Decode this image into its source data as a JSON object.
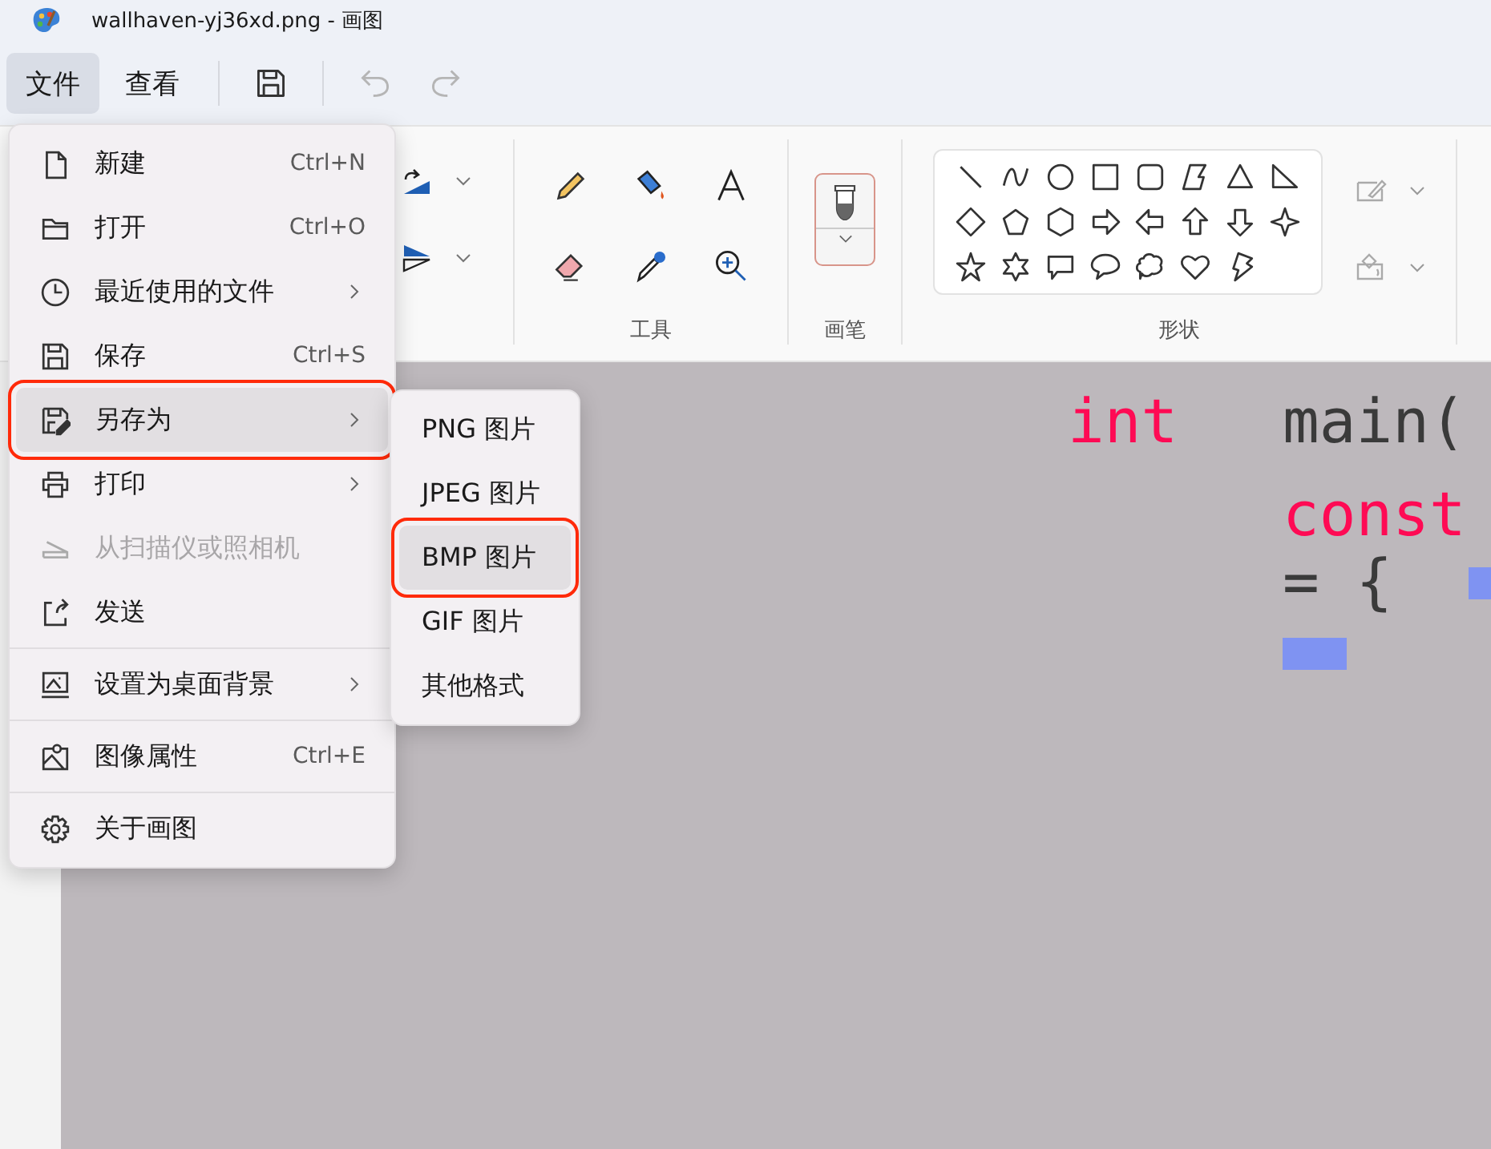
{
  "window": {
    "title": "wallhaven-yj36xd.png - 画图"
  },
  "menubar": [
    {
      "label": "文件",
      "selected": true
    },
    {
      "label": "查看",
      "selected": false
    }
  ],
  "ribbon": {
    "groups": [
      {
        "label": "工具"
      },
      {
        "label": "画笔"
      },
      {
        "label": "形状"
      }
    ]
  },
  "file_menu": {
    "groups": [
      [
        {
          "label": "新建",
          "shortcut": "Ctrl+N",
          "submenu": false,
          "disabled": false,
          "selected": false,
          "highlighted": false
        },
        {
          "label": "打开",
          "shortcut": "Ctrl+O",
          "submenu": false,
          "disabled": false,
          "selected": false,
          "highlighted": false
        },
        {
          "label": "最近使用的文件",
          "submenu": true,
          "disabled": false,
          "selected": false,
          "highlighted": false
        },
        {
          "label": "保存",
          "shortcut": "Ctrl+S",
          "submenu": false,
          "disabled": false,
          "selected": false,
          "highlighted": false
        },
        {
          "label": "另存为",
          "submenu": true,
          "disabled": false,
          "selected": true,
          "highlighted": true
        },
        {
          "label": "打印",
          "submenu": true,
          "disabled": false,
          "selected": false,
          "highlighted": false
        },
        {
          "label": "从扫描仪或照相机",
          "submenu": false,
          "disabled": true,
          "selected": false,
          "highlighted": false
        },
        {
          "label": "发送",
          "submenu": false,
          "disabled": false,
          "selected": false,
          "highlighted": false
        }
      ],
      [
        {
          "label": "设置为桌面背景",
          "submenu": true,
          "disabled": false,
          "selected": false,
          "highlighted": false
        }
      ],
      [
        {
          "label": "图像属性",
          "shortcut": "Ctrl+E",
          "submenu": false,
          "disabled": false,
          "selected": false,
          "highlighted": false
        }
      ],
      [
        {
          "label": "关于画图",
          "submenu": false,
          "disabled": false,
          "selected": false,
          "highlighted": false
        }
      ]
    ]
  },
  "save_as_submenu": [
    {
      "label": "PNG 图片",
      "selected": false,
      "highlighted": false
    },
    {
      "label": "JPEG 图片",
      "selected": false,
      "highlighted": false
    },
    {
      "label": "BMP 图片",
      "selected": true,
      "highlighted": true
    },
    {
      "label": "GIF 图片",
      "selected": false,
      "highlighted": false
    },
    {
      "label": "其他格式",
      "selected": false,
      "highlighted": false
    }
  ],
  "canvas_text": [
    {
      "text": "int",
      "color": "#ff0a54"
    },
    {
      "text": "main(",
      "color": "#3a3a3a"
    },
    {
      "text": "const",
      "color": "#ff0a54"
    },
    {
      "text": "= {",
      "color": "#3a3a3a"
    }
  ]
}
